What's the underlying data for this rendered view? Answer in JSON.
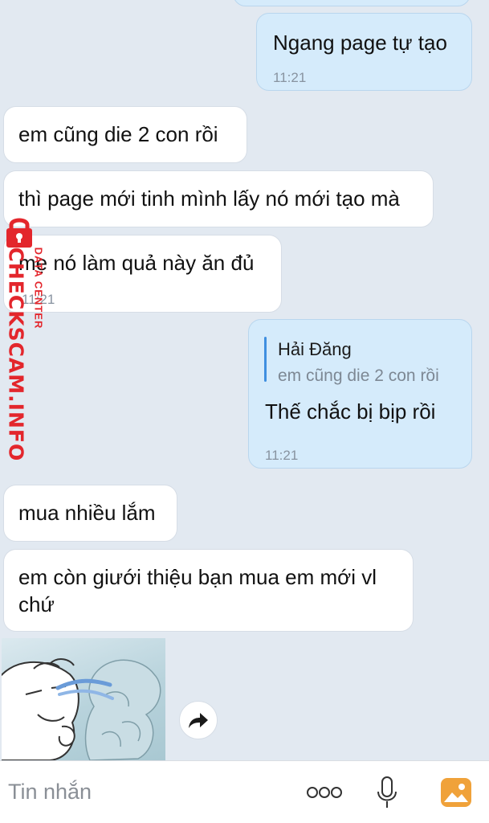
{
  "messages": [
    {
      "dir": "out",
      "text": "Ngang page tự tạo",
      "time": "11:21"
    },
    {
      "dir": "in",
      "text": "em cũng die 2 con rồi"
    },
    {
      "dir": "in",
      "text": "thì page mới tinh mình lấy nó mới tạo mà"
    },
    {
      "dir": "in",
      "text": "mẹ nó làm quả này ăn đủ",
      "time": "11:21"
    },
    {
      "dir": "out",
      "quote": {
        "name": "Hải Đăng",
        "text": "em cũng die 2 con rồi"
      },
      "text": "Thế chắc bị bịp rồi",
      "time": "11:21"
    },
    {
      "dir": "in",
      "text": "mua nhiều lắm"
    },
    {
      "dir": "in",
      "text_line1": "em còn giưới thiệu bạn mua em mới vl",
      "text_line2": "chứ"
    }
  ],
  "watermark": {
    "brand": "CHECKSCAM.INFO",
    "sub": "DATA CENTER"
  },
  "input": {
    "placeholder": "Tin nhắn"
  },
  "icons": {
    "more": "more-dots-icon",
    "mic": "microphone-icon",
    "image": "image-gallery-icon",
    "share": "share-forward-icon",
    "lock": "lock-icon"
  },
  "colors": {
    "background": "#e2e9f1",
    "incoming": "#ffffff",
    "outgoing": "#d5ebfb",
    "quote_bar": "#3f8fe0",
    "watermark": "#e3262c",
    "gallery_icon": "#f0a23a"
  }
}
